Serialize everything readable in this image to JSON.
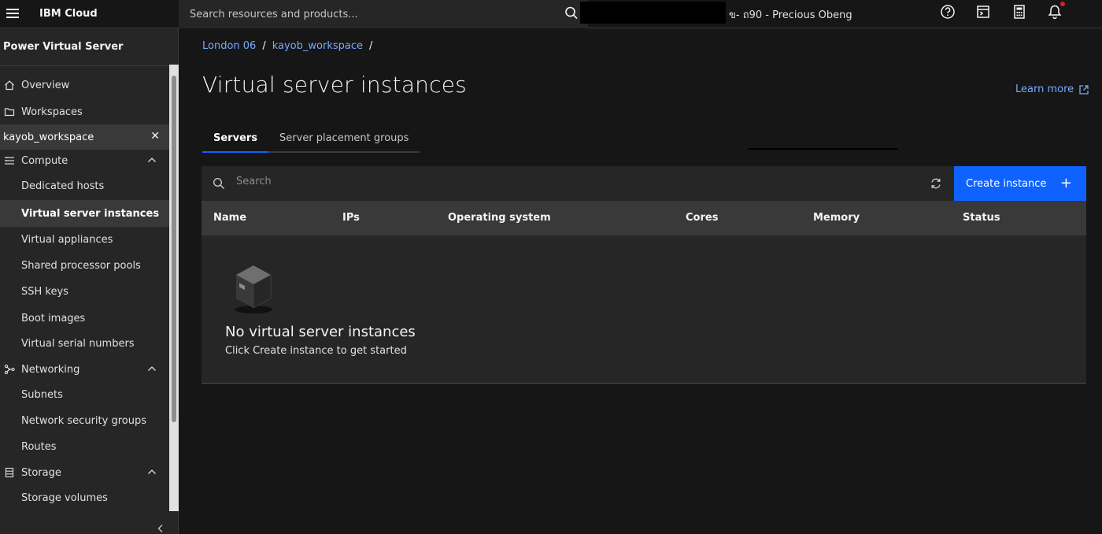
{
  "topbar": {
    "brand": "IBM Cloud",
    "search_placeholder": "Search resources and products...",
    "account_suffix": "ข-   ถ90 - Precious Obeng"
  },
  "sidebar": {
    "title": "Power Virtual Server",
    "items": [
      {
        "label": "Overview",
        "icon": "home-icon"
      },
      {
        "label": "Workspaces",
        "icon": "folder-icon"
      },
      {
        "label": "kayob_workspace",
        "icon": "close-icon"
      },
      {
        "label": "Compute",
        "icon": "compute-icon"
      },
      {
        "label": "Dedicated hosts"
      },
      {
        "label": "Virtual server instances"
      },
      {
        "label": "Virtual appliances"
      },
      {
        "label": "Shared processor pools"
      },
      {
        "label": "SSH keys"
      },
      {
        "label": "Boot images"
      },
      {
        "label": "Virtual serial numbers"
      },
      {
        "label": "Networking",
        "icon": "network-icon"
      },
      {
        "label": "Subnets"
      },
      {
        "label": "Network security groups"
      },
      {
        "label": "Routes"
      },
      {
        "label": "Storage",
        "icon": "storage-icon"
      },
      {
        "label": "Storage volumes"
      }
    ]
  },
  "breadcrumb": [
    "London 06",
    "kayob_workspace"
  ],
  "page_title": "Virtual server instances",
  "learn_more": "Learn more",
  "tabs": [
    "Servers",
    "Server placement groups"
  ],
  "table": {
    "search_placeholder": "Search",
    "create_label": "Create instance",
    "columns": [
      "Name",
      "IPs",
      "Operating system",
      "Cores",
      "Memory",
      "Status"
    ],
    "empty_title": "No virtual server instances",
    "empty_subtitle": "Click Create instance to get started"
  },
  "colors": {
    "accent": "#0f62fe",
    "link": "#78a9ff",
    "notification": "#da1e28"
  }
}
